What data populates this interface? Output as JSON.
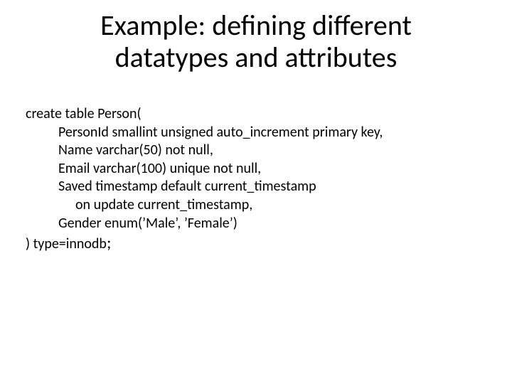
{
  "title_line1": "Example: defining different",
  "title_line2": "datatypes and attributes",
  "code": {
    "l0": "create table Person(",
    "l1": "PersonId smallint unsigned auto_increment primary key,",
    "l2": "Name varchar(50) not null,",
    "l3": "Email varchar(100) unique not null,",
    "l4": "Saved timestamp default current_timestamp",
    "l5": "on update current_timestamp,",
    "l6": "Gender  enum(’Male’, ’Female’)",
    "l7a": ") type=innodb",
    "l7b": ";"
  }
}
